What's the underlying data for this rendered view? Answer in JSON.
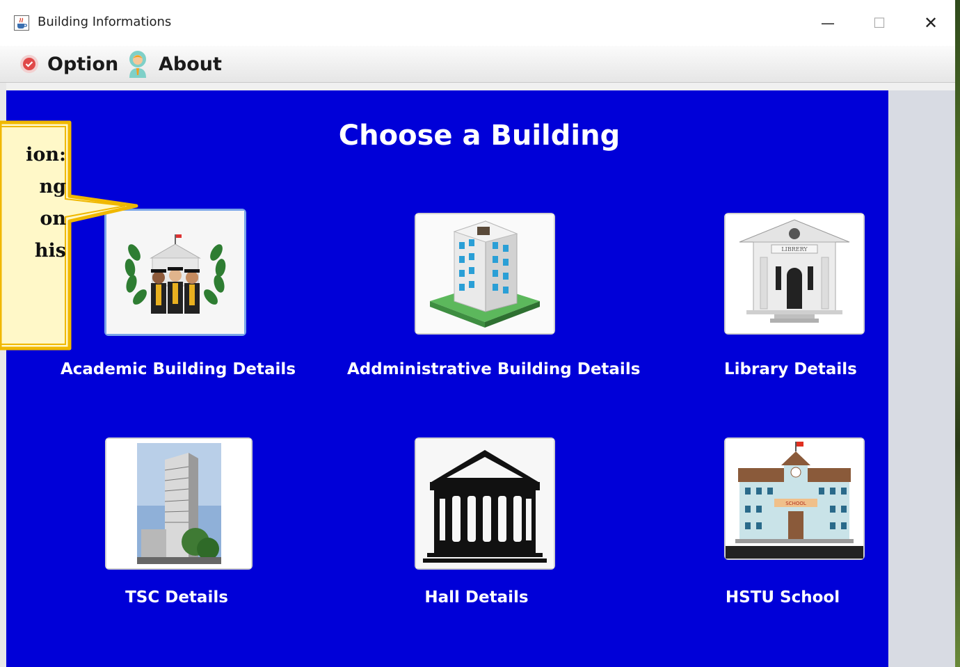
{
  "window": {
    "title": "Building Informations",
    "minimize_label": "—",
    "maximize_label": "☐",
    "close_label": "✕"
  },
  "menu": {
    "option_label": "Option",
    "about_label": "About"
  },
  "main": {
    "heading": "Choose a Building"
  },
  "buildings": [
    {
      "label": "Academic Building Details"
    },
    {
      "label": "Addministrative Building Details"
    },
    {
      "label": "Library Details"
    },
    {
      "label": "TSC Details"
    },
    {
      "label": "Hall Details"
    },
    {
      "label": "HSTU School"
    }
  ],
  "library_sign": "LIBRERY",
  "school_sign": "SCHOOL",
  "callout": {
    "lines": [
      "ion:",
      "ng",
      "on",
      "his"
    ]
  },
  "colors": {
    "main_bg": "#0000d8",
    "callout_fill": "#fff8c8",
    "callout_border": "#f0b800"
  },
  "icons": {
    "option": "red-circle-icon",
    "about": "person-icon",
    "app": "java-cup-icon"
  }
}
